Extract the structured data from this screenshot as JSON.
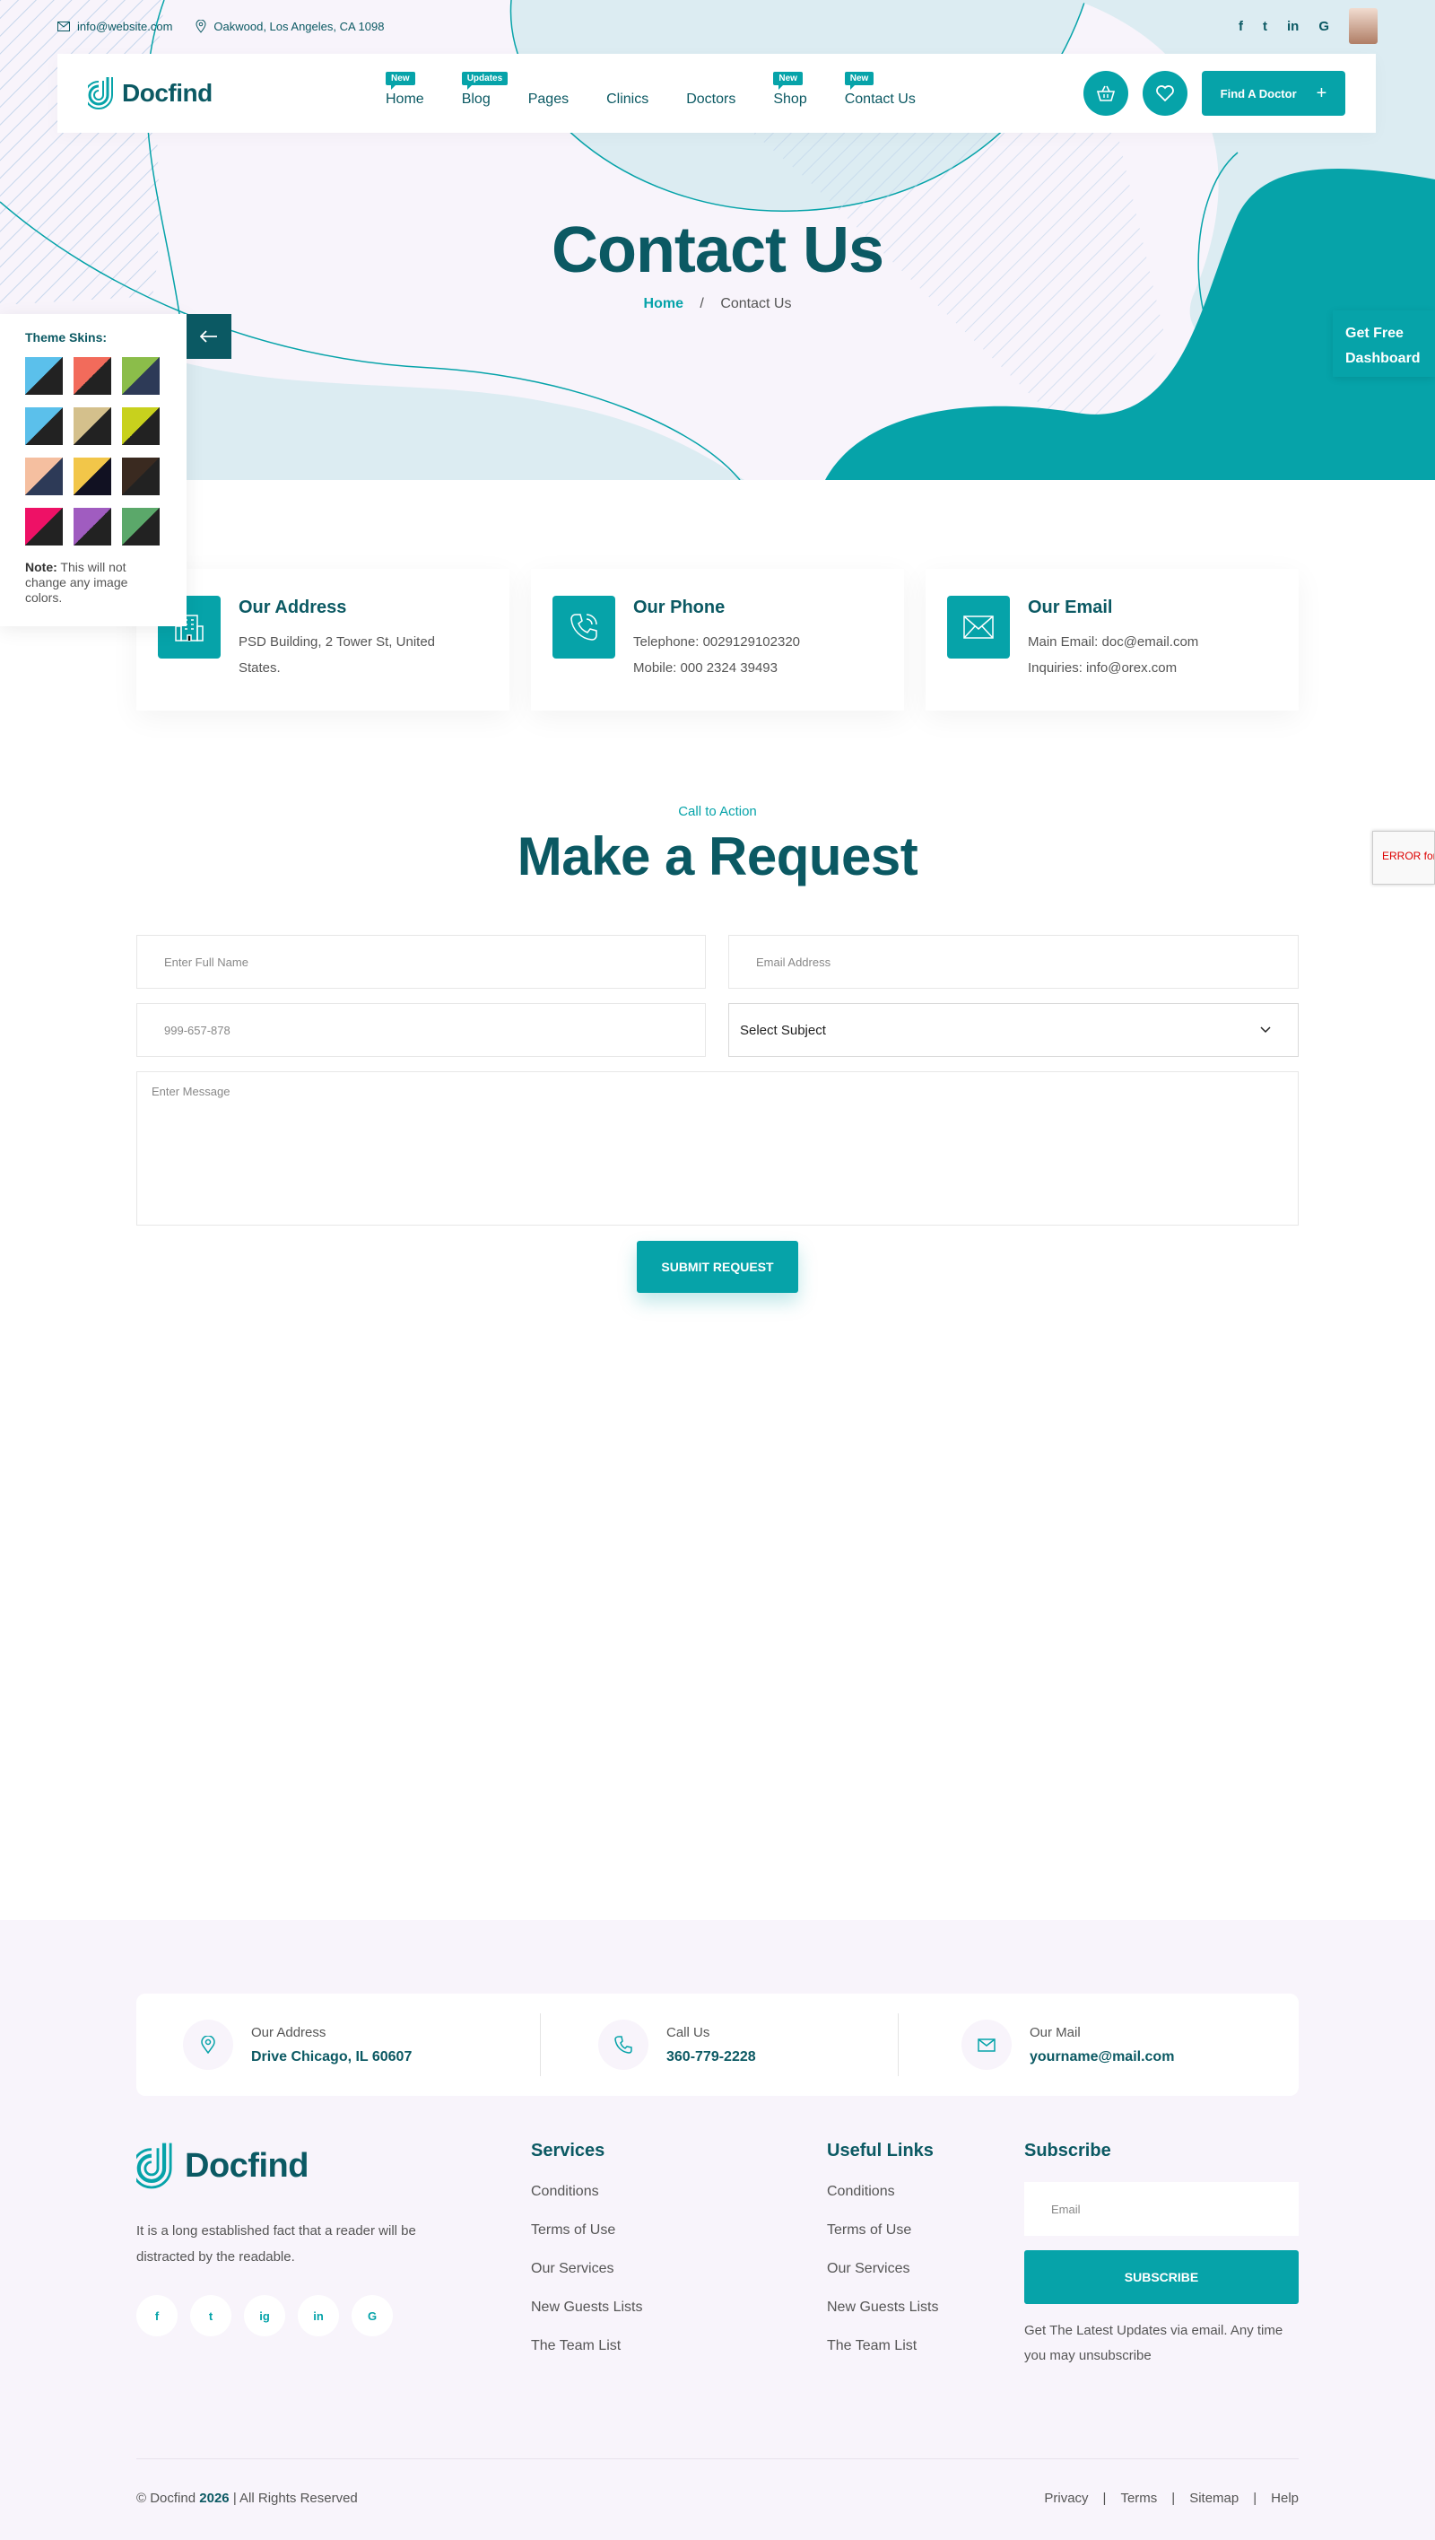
{
  "topbar": {
    "email": "info@website.com",
    "location": "Oakwood, Los Angeles, CA 1098",
    "social": [
      "f",
      "t",
      "in",
      "G"
    ]
  },
  "brand": {
    "name": "Docfind"
  },
  "nav": {
    "items": [
      {
        "label": "Home",
        "badge": "New"
      },
      {
        "label": "Blog",
        "badge": "Updates"
      },
      {
        "label": "Pages",
        "badge": ""
      },
      {
        "label": "Clinics",
        "badge": ""
      },
      {
        "label": "Doctors",
        "badge": ""
      },
      {
        "label": "Shop",
        "badge": "New"
      },
      {
        "label": "Contact Us",
        "badge": "New"
      }
    ],
    "cta": "Find A Doctor"
  },
  "hero": {
    "title": "Contact Us",
    "breadcrumb_home": "Home",
    "breadcrumb_sep": "/",
    "breadcrumb_current": "Contact Us"
  },
  "theme_panel": {
    "title": "Theme Skins:",
    "note_bold": "Note:",
    "note": " This will not change any image colors.",
    "swatches": [
      [
        "#5bc0eb",
        "#222222"
      ],
      [
        "#f26b5b",
        "#222222"
      ],
      [
        "#8bbd4a",
        "#2d3a57"
      ],
      [
        "#5bc0eb",
        "#222222"
      ],
      [
        "#d4c08c",
        "#222222"
      ],
      [
        "#c8d11d",
        "#222222"
      ],
      [
        "#f5bfa0",
        "#2d3a57"
      ],
      [
        "#f2c649",
        "#111122"
      ],
      [
        "#3a2a20",
        "#222222"
      ],
      [
        "#ee1166",
        "#222222"
      ],
      [
        "#a05cc0",
        "#222222"
      ],
      [
        "#5ba86a",
        "#222222"
      ]
    ]
  },
  "side_widget": {
    "label": "Get Free Dashboard"
  },
  "recaptcha": {
    "text": "ERROR for site owner: Invalid domain"
  },
  "contact_cards": [
    {
      "title": "Our Address",
      "lines": [
        "PSD Building, 2 Tower St, United",
        "States."
      ]
    },
    {
      "title": "Our Phone",
      "lines": [
        "Telephone: 0029129102320",
        "Mobile: 000 2324 39493"
      ]
    },
    {
      "title": "Our Email",
      "lines": [
        "Main Email: doc@email.com",
        "Inquiries: info@orex.com"
      ]
    }
  ],
  "request_form": {
    "eyebrow": "Call to Action",
    "title": "Make a Request",
    "name_placeholder": "Enter Full Name",
    "email_placeholder": "Email Address",
    "phone_placeholder": "999-657-878",
    "subject_selected": "Select Subject",
    "message_placeholder": "Enter Message",
    "submit": "SUBMIT REQUEST"
  },
  "footer": {
    "info": [
      {
        "label": "Our Address",
        "value": "Drive Chicago, IL 60607"
      },
      {
        "label": "Call Us",
        "value": "360-779-2228"
      },
      {
        "label": "Our Mail",
        "value": "yourname@mail.com"
      }
    ],
    "description": "It is a long established fact that a reader will be distracted by the readable.",
    "social": [
      "f",
      "t",
      "ig",
      "in",
      "G"
    ],
    "services_title": "Services",
    "services": [
      "Conditions",
      "Terms of Use",
      "Our Services",
      "New Guests Lists",
      "The Team List"
    ],
    "links_title": "Useful Links",
    "links": [
      "Conditions",
      "Terms of Use",
      "Our Services",
      "New Guests Lists",
      "The Team List"
    ],
    "subscribe_title": "Subscribe",
    "subscribe_placeholder": "Email",
    "subscribe_button": "SUBSCRIBE",
    "subscribe_note": "Get The Latest Updates via email. Any time you may unsubscribe",
    "copyright_prefix": "© Docfind",
    "copyright_year": "2026",
    "copyright_suffix": "| All Rights Reserved",
    "bottom_links": [
      "Privacy",
      "Terms",
      "Sitemap",
      "Help"
    ]
  },
  "colors": {
    "primary": "#06a3a9",
    "dark": "#0b5963",
    "hero_bg": "#f8f4fb",
    "blob_light": "#dcecf2"
  }
}
